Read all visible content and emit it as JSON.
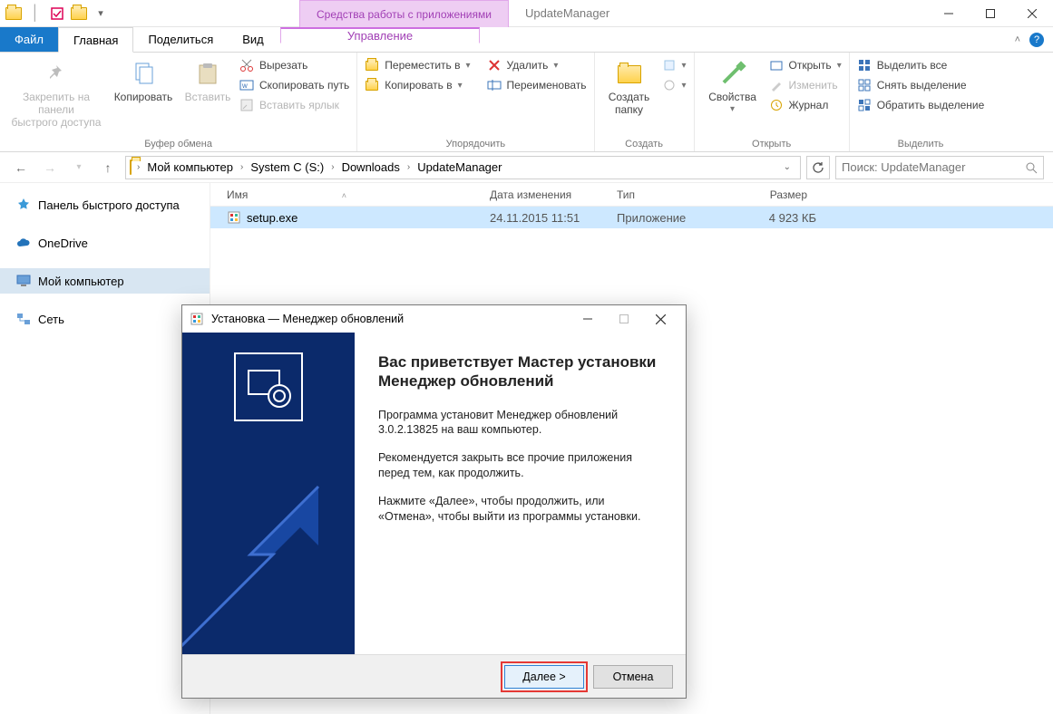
{
  "titleBar": {
    "contextGroupLabel": "Средства работы с приложениями",
    "windowTitle": "UpdateManager"
  },
  "tabs": {
    "file": "Файл",
    "home": "Главная",
    "share": "Поделиться",
    "view": "Вид",
    "context": "Управление"
  },
  "ribbon": {
    "clipboard": {
      "pin": "Закрепить на панели\nбыстрого доступа",
      "copy": "Копировать",
      "paste": "Вставить",
      "cut": "Вырезать",
      "copyPath": "Скопировать путь",
      "pasteShortcut": "Вставить ярлык",
      "group": "Буфер обмена"
    },
    "organize": {
      "moveTo": "Переместить в",
      "copyTo": "Копировать в",
      "delete": "Удалить",
      "rename": "Переименовать",
      "group": "Упорядочить"
    },
    "new": {
      "newFolder": "Создать\nпапку",
      "group": "Создать"
    },
    "open": {
      "properties": "Свойства",
      "open": "Открыть",
      "edit": "Изменить",
      "history": "Журнал",
      "group": "Открыть"
    },
    "select": {
      "selectAll": "Выделить все",
      "selectNone": "Снять выделение",
      "invert": "Обратить выделение",
      "group": "Выделить"
    }
  },
  "breadcrumb": {
    "items": [
      "Мой компьютер",
      "System C (S:)",
      "Downloads",
      "UpdateManager"
    ]
  },
  "search": {
    "placeholder": "Поиск: UpdateManager"
  },
  "sidebar": {
    "quickAccess": "Панель быстрого доступа",
    "oneDrive": "OneDrive",
    "thisPC": "Мой компьютер",
    "network": "Сеть"
  },
  "columns": {
    "name": "Имя",
    "date": "Дата изменения",
    "type": "Тип",
    "size": "Размер"
  },
  "files": [
    {
      "name": "setup.exe",
      "date": "24.11.2015 11:51",
      "type": "Приложение",
      "size": "4 923 КБ"
    }
  ],
  "dialog": {
    "title": "Установка — Менеджер обновлений",
    "heading": "Вас приветствует Мастер установки Менеджер обновлений",
    "p1": "Программа установит Менеджер обновлений 3.0.2.13825 на ваш компьютер.",
    "p2": "Рекомендуется закрыть все прочие приложения перед тем, как продолжить.",
    "p3": "Нажмите «Далее», чтобы продолжить, или «Отмена», чтобы выйти из программы установки.",
    "next": "Далее >",
    "cancel": "Отмена"
  }
}
